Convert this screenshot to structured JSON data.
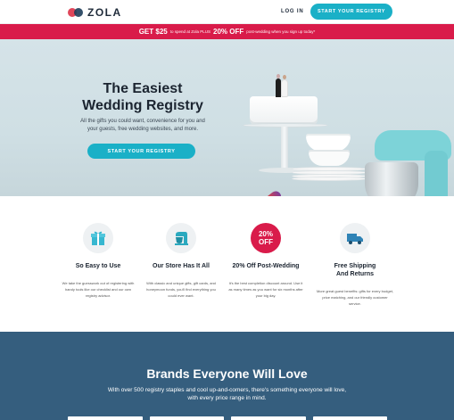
{
  "header": {
    "logo_text": "ZOLA",
    "login_label": "LOG IN",
    "cta_label": "START YOUR REGISTRY"
  },
  "promo": {
    "part1": "GET $25",
    "part2": "to spend at Zola PLUS",
    "part3": "20% OFF",
    "part4": "post-wedding when you sign up today*"
  },
  "hero": {
    "title_line1": "The Easiest",
    "title_line2": "Wedding Registry",
    "subtitle_line1": "All the gifts you could want, convenience for you and",
    "subtitle_line2": "your guests, free wedding websites, and more.",
    "cta_label": "START YOUR REGISTRY"
  },
  "features": [
    {
      "icon": "gift-icon",
      "title": "So Easy to Use",
      "title_line2": "",
      "desc": "We take the guesswork out of registering with handy tools like our checklist and our own registry advisor."
    },
    {
      "icon": "mixer-icon",
      "title": "Our Store Has It All",
      "title_line2": "",
      "desc": "With classic and unique gifts, gift cards, and honeymoon funds, you'll find everything you could ever want."
    },
    {
      "icon": "discount-badge-icon",
      "badge_top": "20%",
      "badge_bottom": "OFF",
      "title": "20% Off Post-Wedding",
      "title_line2": "",
      "desc": "It's the best completion discount around. Use it as many times as you want for six months after your big day."
    },
    {
      "icon": "truck-icon",
      "title": "Free Shipping",
      "title_line2": "And Returns",
      "desc": "More great guest benefits: gifts for every budget, price matching, and our friendly customer service."
    }
  ],
  "brands": {
    "title": "Brands Everyone Will Love",
    "sub_line1": "With over 500 registry staples and cool up-and-comers, there's something everyone will love,",
    "sub_line2": "with every price range in mind."
  },
  "colors": {
    "accent_teal": "#1ab0c7",
    "promo_red": "#d91b4a",
    "brands_blue": "#355e7e"
  }
}
